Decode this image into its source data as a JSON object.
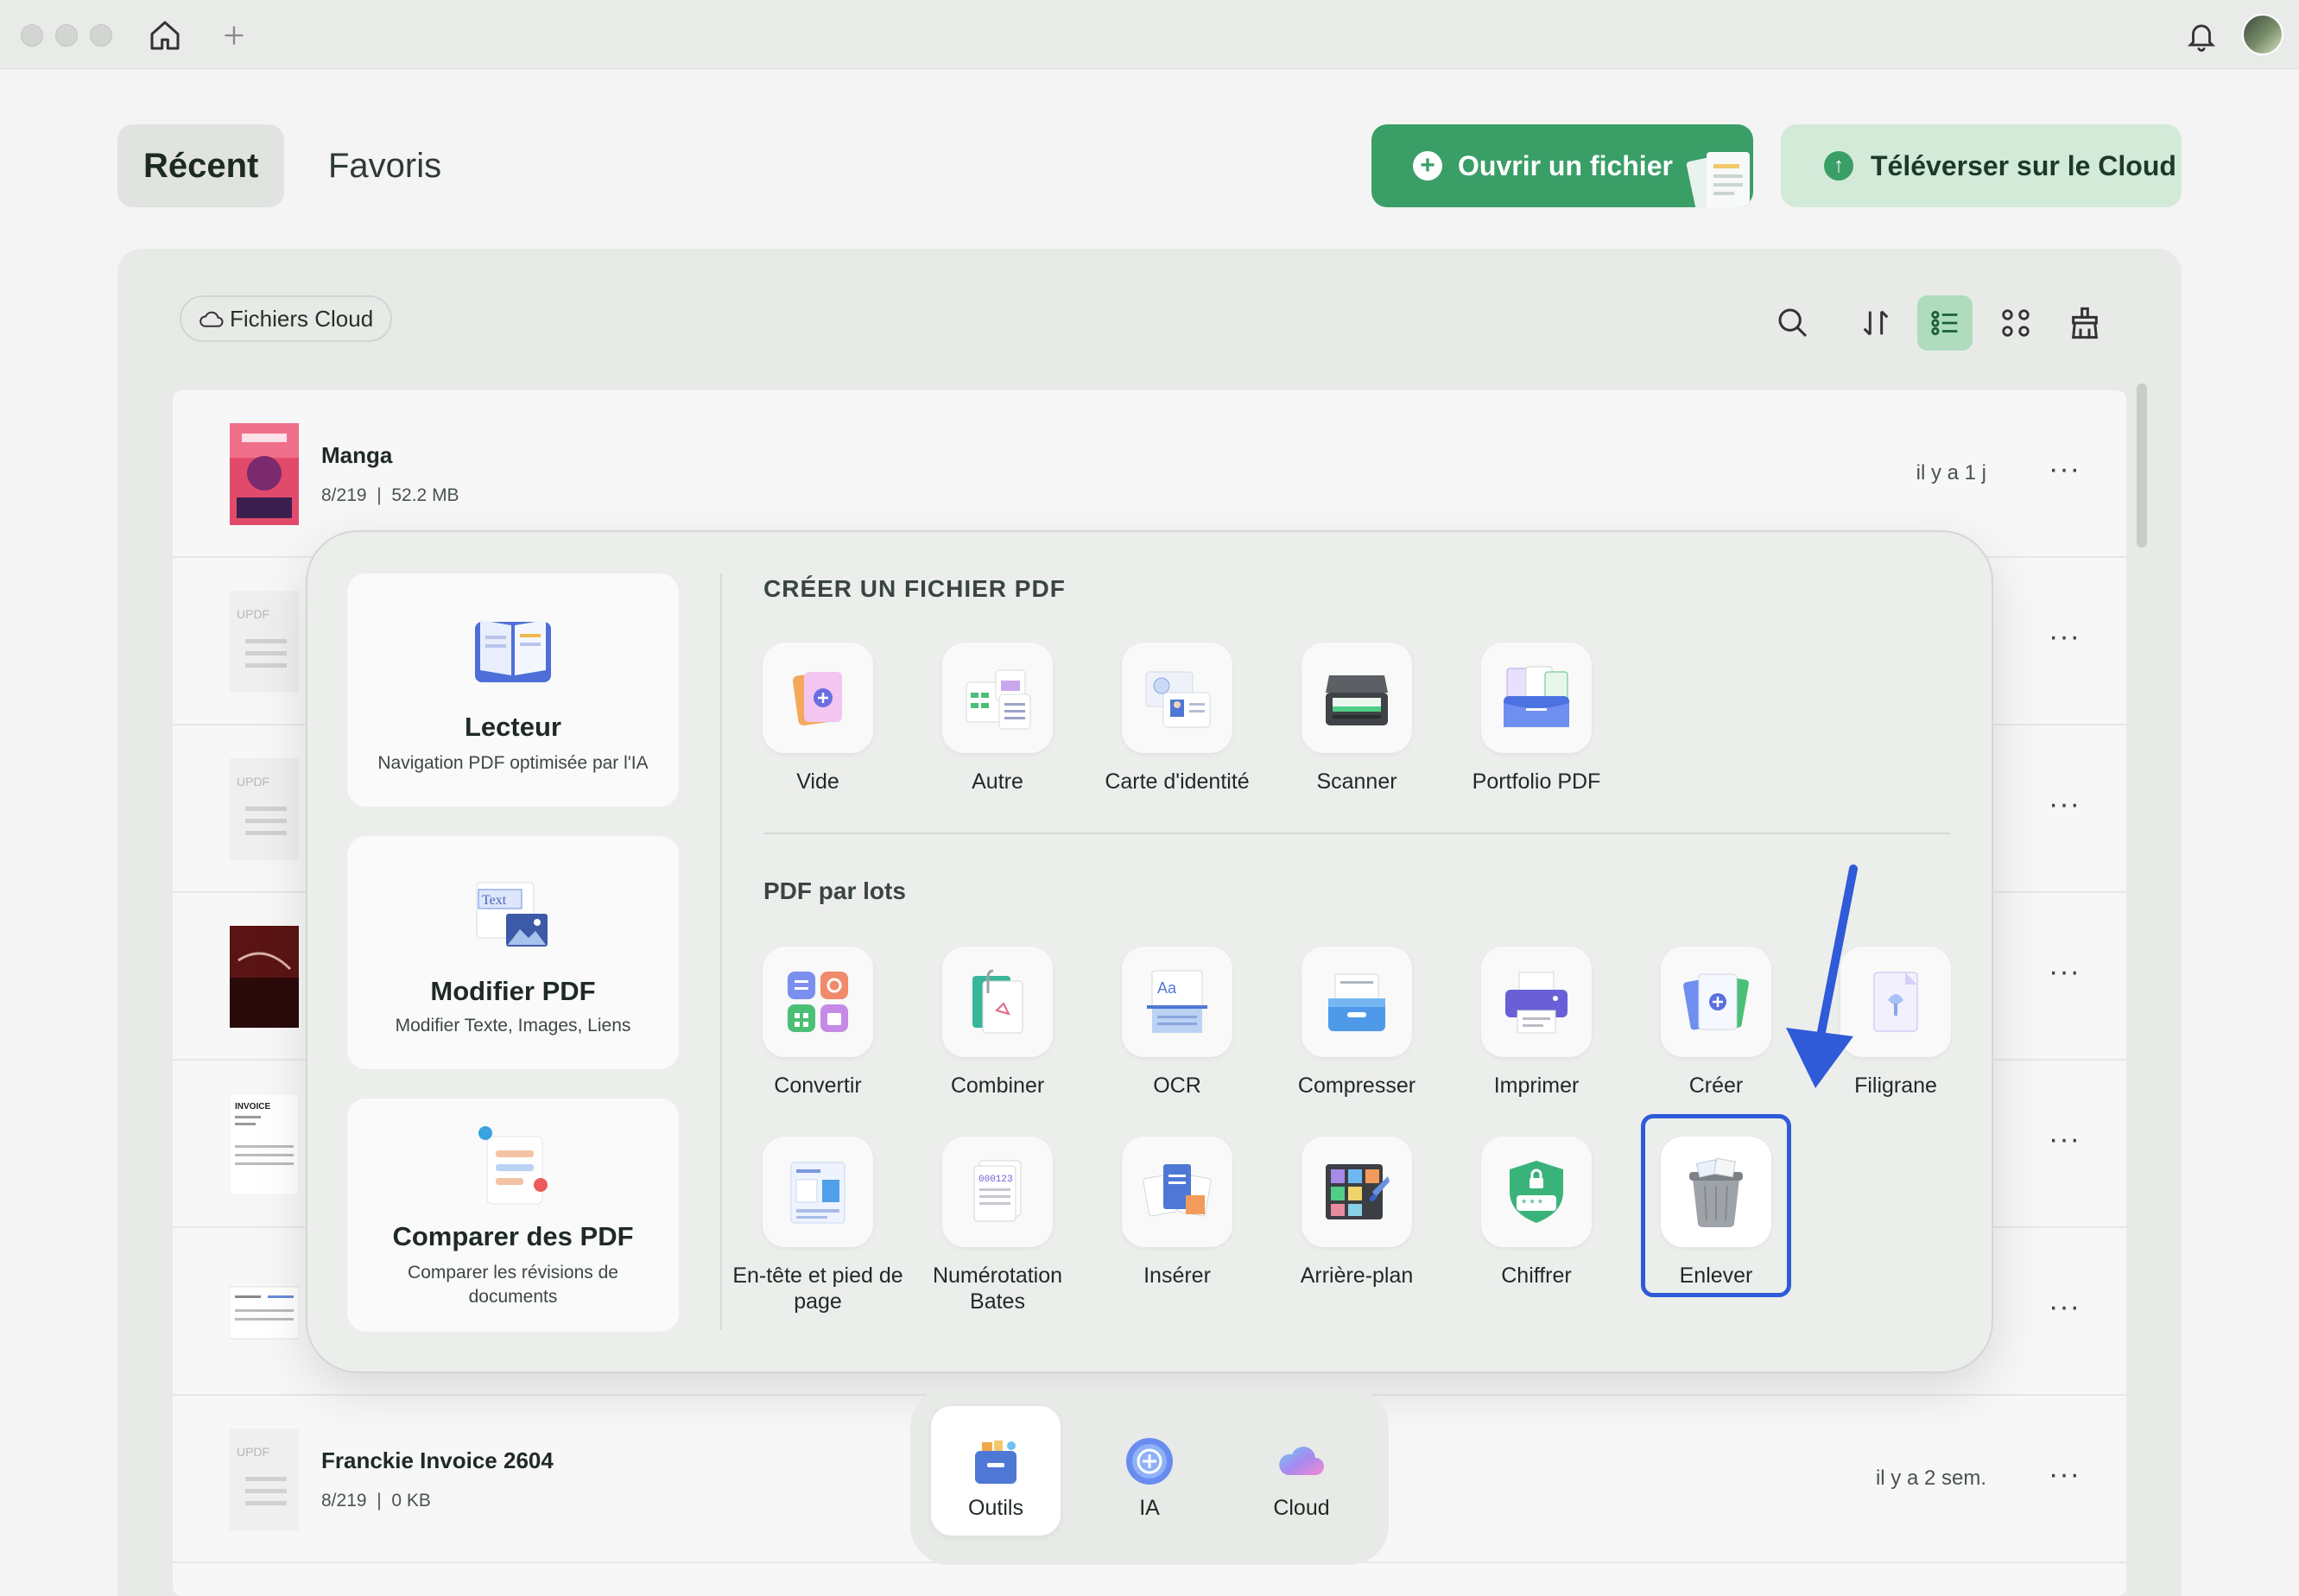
{
  "titlebar": {
    "home_icon": "home-icon",
    "new_tab_icon": "plus-icon",
    "bell_icon": "bell-icon"
  },
  "tabs": {
    "recent": "Récent",
    "favorites": "Favoris"
  },
  "actions": {
    "open_file": "Ouvrir un fichier",
    "upload_cloud": "Téléverser sur le Cloud"
  },
  "filter": {
    "cloud_files": "Fichiers Cloud"
  },
  "toolbar_icons": [
    "search-icon",
    "sort-icon",
    "list-view-icon",
    "grid-view-icon",
    "clean-icon"
  ],
  "files": [
    {
      "name": "Manga",
      "pages": "8/219",
      "size": "52.2 MB",
      "time": "il y a 1 j"
    },
    {
      "name": "Franckie Invoice 2604",
      "pages": "8/219",
      "size": "0 KB",
      "time": "il y a 2 sem."
    }
  ],
  "thumb_texts": {
    "updf": "UPDF",
    "invoice": "INVOICE"
  },
  "more_glyph": "···",
  "features": [
    {
      "title": "Lecteur",
      "subtitle": "Navigation PDF optimisée par l'IA"
    },
    {
      "title": "Modifier PDF",
      "subtitle": "Modifier Texte, Images, Liens",
      "icon_text": "Text"
    },
    {
      "title": "Comparer des PDF",
      "subtitle": "Comparer les révisions de documents"
    }
  ],
  "create_section": {
    "title": "CRÉER UN FICHIER PDF",
    "items": [
      "Vide",
      "Autre",
      "Carte d'identité",
      "Scanner",
      "Portfolio PDF"
    ]
  },
  "batch_section": {
    "title": "PDF par lots",
    "row1": [
      "Convertir",
      "Combiner",
      "OCR",
      "Compresser",
      "Imprimer",
      "Créer",
      "Filigrane"
    ],
    "row2": [
      "En-tête et pied de page",
      "Numérotation Bates",
      "Insérer",
      "Arrière-plan",
      "Chiffrer",
      "Enlever"
    ]
  },
  "dock": [
    "Outils",
    "IA",
    "Cloud"
  ],
  "colors": {
    "accent_green": "#3a9e67",
    "highlight_blue": "#2f5bd8",
    "arrow_blue": "#2f5bd8"
  }
}
